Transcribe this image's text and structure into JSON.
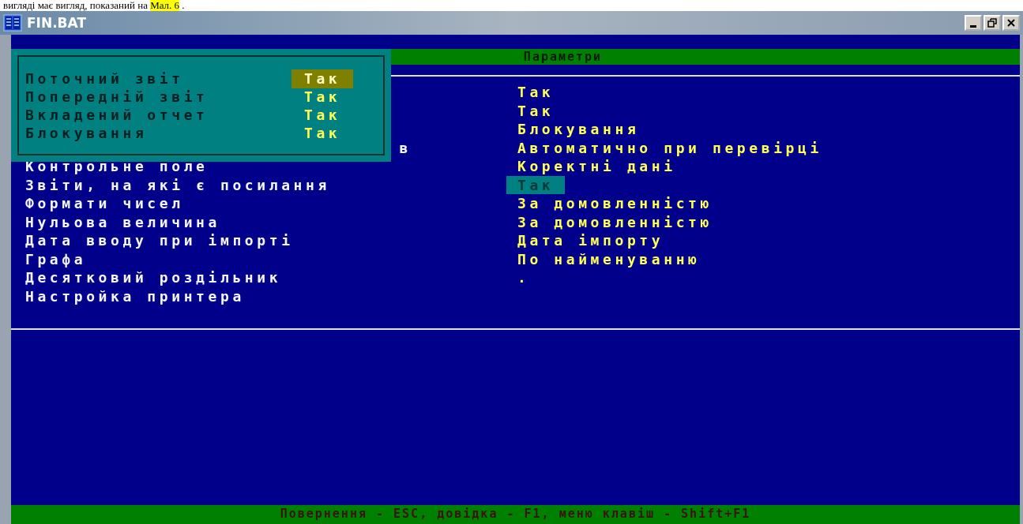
{
  "caption": {
    "before": "вигляді має вигляд, показаний на",
    "highlight": "Мал. 6",
    "after": "."
  },
  "window": {
    "title": "FIN.BAT"
  },
  "header": "Параметри",
  "popup": {
    "items": [
      {
        "label": "Поточний звіт",
        "value": "Так",
        "selected": true
      },
      {
        "label": "Попередній звіт",
        "value": "Так",
        "selected": false
      },
      {
        "label": "Вкладений отчет",
        "value": "Так",
        "selected": false
      },
      {
        "label": "Блокування",
        "value": "Так",
        "selected": false
      }
    ]
  },
  "settings": {
    "rows": [
      {
        "value": "Так",
        "selected": false
      },
      {
        "value": "Так",
        "selected": false
      },
      {
        "value": "Блокування",
        "selected": false
      },
      {
        "label": "в",
        "value": "Автоматично при перевірці",
        "selected": false
      },
      {
        "label": "Контрольне поле",
        "value": "Коректні дані",
        "selected": false
      },
      {
        "label": "Звіти, на які є посилання",
        "value": "Так",
        "selected": true
      },
      {
        "label": "Формати чисел",
        "value": "За домовленністю",
        "selected": false
      },
      {
        "label": "Нульова величина",
        "value": "За домовленністю",
        "selected": false
      },
      {
        "label": "Дата вводу при імпорті",
        "value": "Дата імпорту",
        "selected": false
      },
      {
        "label": "Графа",
        "value": "По найменуванню",
        "selected": false
      },
      {
        "label": "Десятковий роздільник",
        "value": ".",
        "selected": false
      },
      {
        "label": "Настройка принтера",
        "selected": false
      }
    ]
  },
  "status_bar": "Повернення - ESC, довідка - F1, меню клавіш - Shift+F1"
}
